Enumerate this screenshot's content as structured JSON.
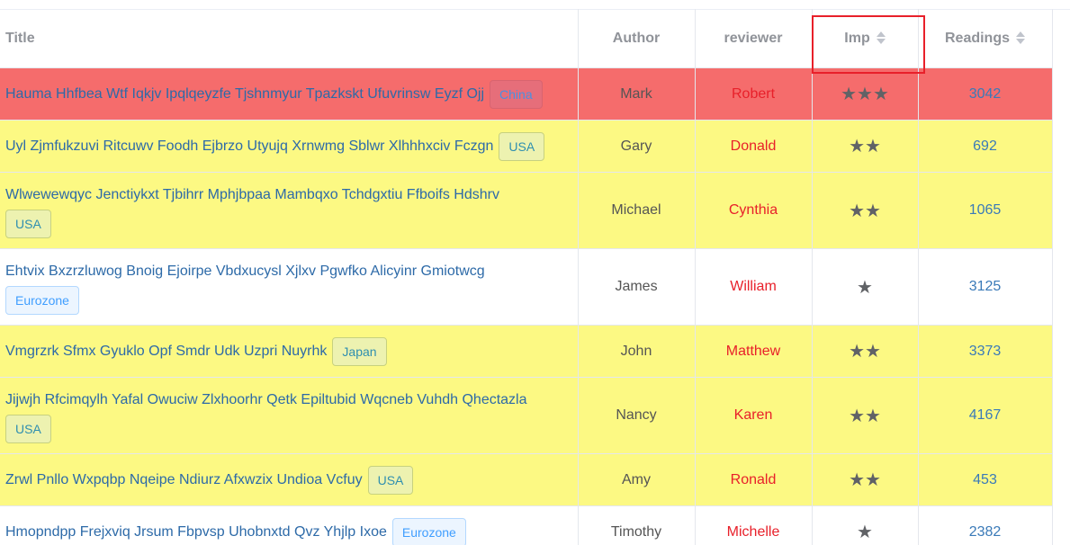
{
  "table": {
    "headers": {
      "title": "Title",
      "author": "Author",
      "reviewer": "reviewer",
      "imp": "Imp",
      "readings": "Readings"
    },
    "rows": [
      {
        "title": "Hauma Hhfbea Wtf Iqkjv Ipqlqeyzfe Tjshnmyur Tpazkskt Ufuvrinsw Eyzf Ojj",
        "tag": "China",
        "author": "Mark",
        "reviewer": "Robert",
        "imp": 3,
        "readings": "3042",
        "row_color": "#f56c6c"
      },
      {
        "title": "Uyl Zjmfukzuvi Ritcuwv Foodh Ejbrzo Utyujq Xrnwmg Sblwr Xlhhhxciv Fczgn",
        "tag": "USA",
        "author": "Gary",
        "reviewer": "Donald",
        "imp": 2,
        "readings": "692",
        "row_color": "#fcf983"
      },
      {
        "title": "Wlwewewqyc Jenctiykxt Tjbihrr Mphjbpaa Mambqxo Tchdgxtiu Ffboifs Hdshrv",
        "tag": "USA",
        "author": "Michael",
        "reviewer": "Cynthia",
        "imp": 2,
        "readings": "1065",
        "row_color": "#fcf983"
      },
      {
        "title": "Ehtvix Bxzrzluwog Bnoig Ejoirpe Vbdxucysl Xjlxv Pgwfko Alicyinr Gmiotwcg",
        "tag": "Eurozone",
        "author": "James",
        "reviewer": "William",
        "imp": 1,
        "readings": "3125",
        "row_color": "#ffffff"
      },
      {
        "title": "Vmgrzrk Sfmx Gyuklo Opf Smdr Udk Uzpri Nuyrhk",
        "tag": "Japan",
        "author": "John",
        "reviewer": "Matthew",
        "imp": 2,
        "readings": "3373",
        "row_color": "#fcf983"
      },
      {
        "title": "Jijwjh Rfcimqylh Yafal Owuciw Zlxhoorhr Qetk Epiltubid Wqcneb Vuhdh Qhectazla",
        "tag": "USA",
        "author": "Nancy",
        "reviewer": "Karen",
        "imp": 2,
        "readings": "4167",
        "row_color": "#fcf983"
      },
      {
        "title": "Zrwl Pnllo Wxpqbp Nqeipe Ndiurz Afxwzix Undioa Vcfuy",
        "tag": "USA",
        "author": "Amy",
        "reviewer": "Ronald",
        "imp": 2,
        "readings": "453",
        "row_color": "#fcf983"
      },
      {
        "title": "Hmopndpp Frejxviq Jrsum Fbpvsp Uhobnxtd Qvz Yhjlp Ixoe",
        "tag": "Eurozone",
        "author": "Timothy",
        "reviewer": "Michelle",
        "imp": 1,
        "readings": "2382",
        "row_color": "#ffffff"
      }
    ]
  },
  "colors": {
    "red_row": "#f56c6c",
    "yellow_row": "#fcf983",
    "reviewer_text": "#e8202a",
    "link_text": "#2d6aa8",
    "highlight_box": "#e8202a"
  },
  "icons": {
    "sort": "sort-caret-icon",
    "star": "star-icon"
  }
}
